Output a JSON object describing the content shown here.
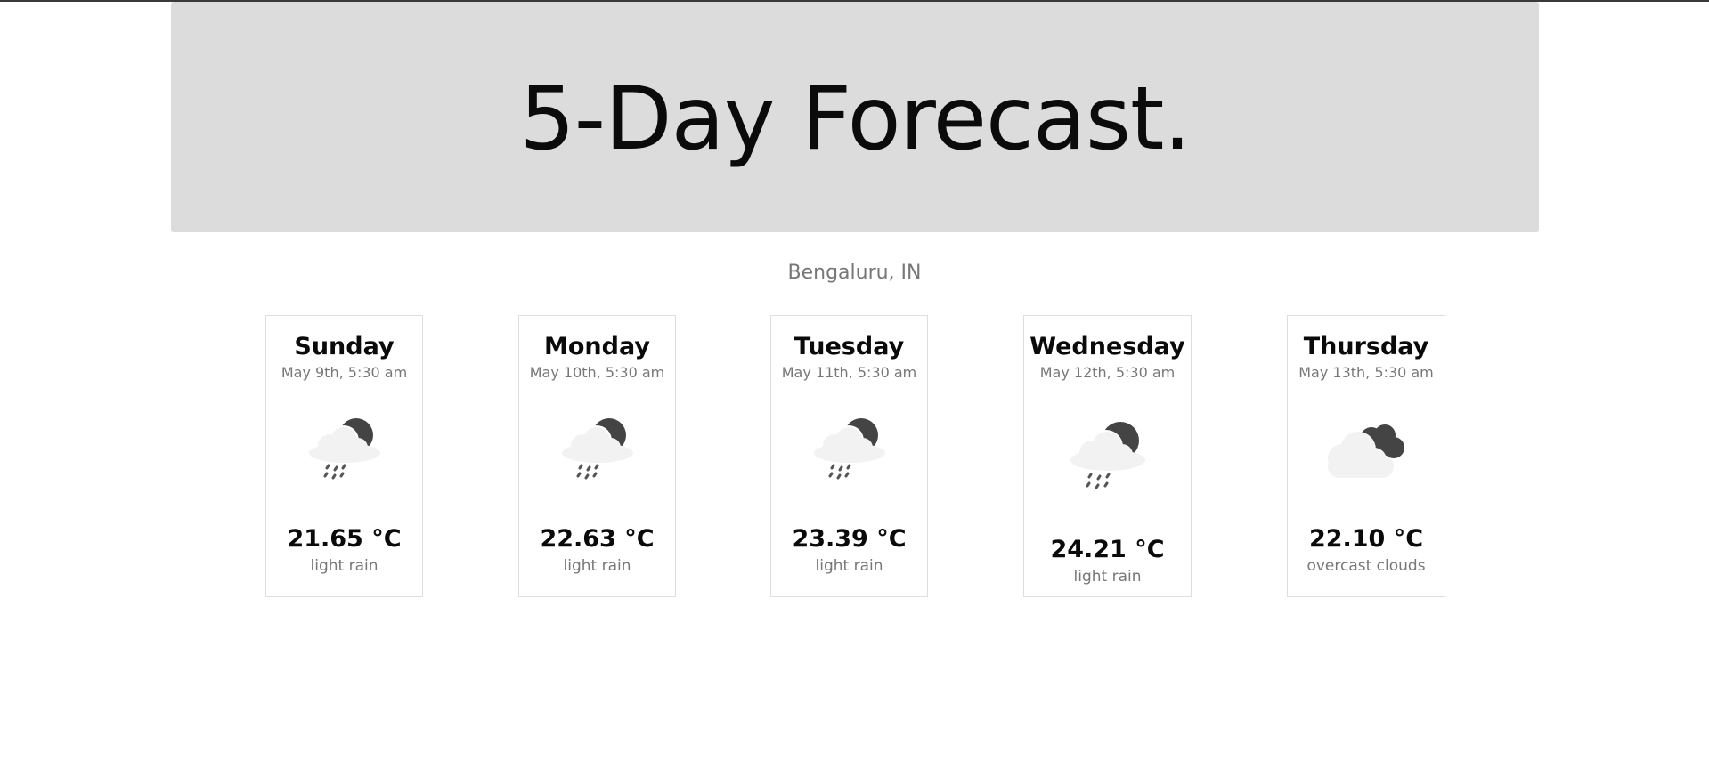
{
  "header": {
    "title": "5-Day Forecast."
  },
  "location": "Bengaluru, IN",
  "forecast": [
    {
      "day": "Sunday",
      "date": "May 9th, 5:30 am",
      "temp": "21.65 °C",
      "desc": "light rain",
      "icon": "rain-moon-icon"
    },
    {
      "day": "Monday",
      "date": "May 10th, 5:30 am",
      "temp": "22.63 °C",
      "desc": "light rain",
      "icon": "rain-moon-icon"
    },
    {
      "day": "Tuesday",
      "date": "May 11th, 5:30 am",
      "temp": "23.39 °C",
      "desc": "light rain",
      "icon": "rain-moon-icon"
    },
    {
      "day": "Wednesday",
      "date": "May 12th, 5:30 am",
      "temp": "24.21 °C",
      "desc": "light rain",
      "icon": "rain-moon-icon"
    },
    {
      "day": "Thursday",
      "date": "May 13th, 5:30 am",
      "temp": "22.10 °C",
      "desc": "overcast clouds",
      "icon": "overcast-clouds-icon"
    }
  ]
}
